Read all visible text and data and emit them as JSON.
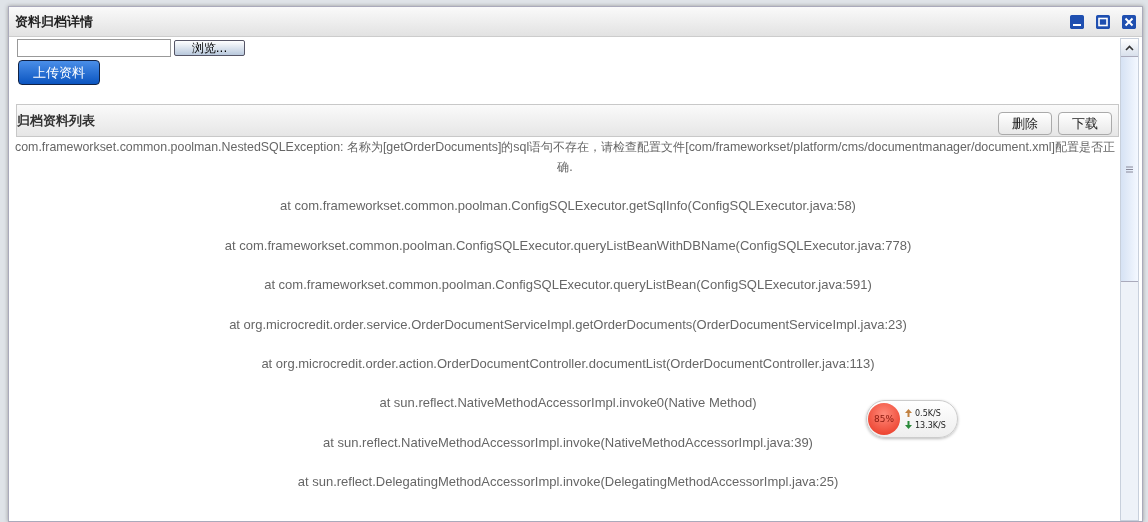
{
  "window": {
    "title": "资料归档详情"
  },
  "upload": {
    "browse_button": "浏览...",
    "upload_button": "上传资料"
  },
  "panel": {
    "title": "归档资料列表",
    "buttons": [
      "删除",
      "下载"
    ]
  },
  "error": {
    "message": "com.frameworkset.common.poolman.NestedSQLException: 名称为[getOrderDocuments]的sql语句不存在，请检查配置文件[com/frameworkset/platform/cms/documentmanager/document.xml]配置是否正确.",
    "trace": [
      "at com.frameworkset.common.poolman.ConfigSQLExecutor.getSqlInfo(ConfigSQLExecutor.java:58)",
      "at com.frameworkset.common.poolman.ConfigSQLExecutor.queryListBeanWithDBName(ConfigSQLExecutor.java:778)",
      "at com.frameworkset.common.poolman.ConfigSQLExecutor.queryListBean(ConfigSQLExecutor.java:591)",
      "at org.microcredit.order.service.OrderDocumentServiceImpl.getOrderDocuments(OrderDocumentServiceImpl.java:23)",
      "at org.microcredit.order.action.OrderDocumentController.documentList(OrderDocumentController.java:113)",
      "at sun.reflect.NativeMethodAccessorImpl.invoke0(Native Method)",
      "at sun.reflect.NativeMethodAccessorImpl.invoke(NativeMethodAccessorImpl.java:39)",
      "at sun.reflect.DelegatingMethodAccessorImpl.invoke(DelegatingMethodAccessorImpl.java:25)"
    ]
  },
  "net_monitor": {
    "percent": "85%",
    "upload": "0.5K/S",
    "download": "13.3K/S"
  }
}
